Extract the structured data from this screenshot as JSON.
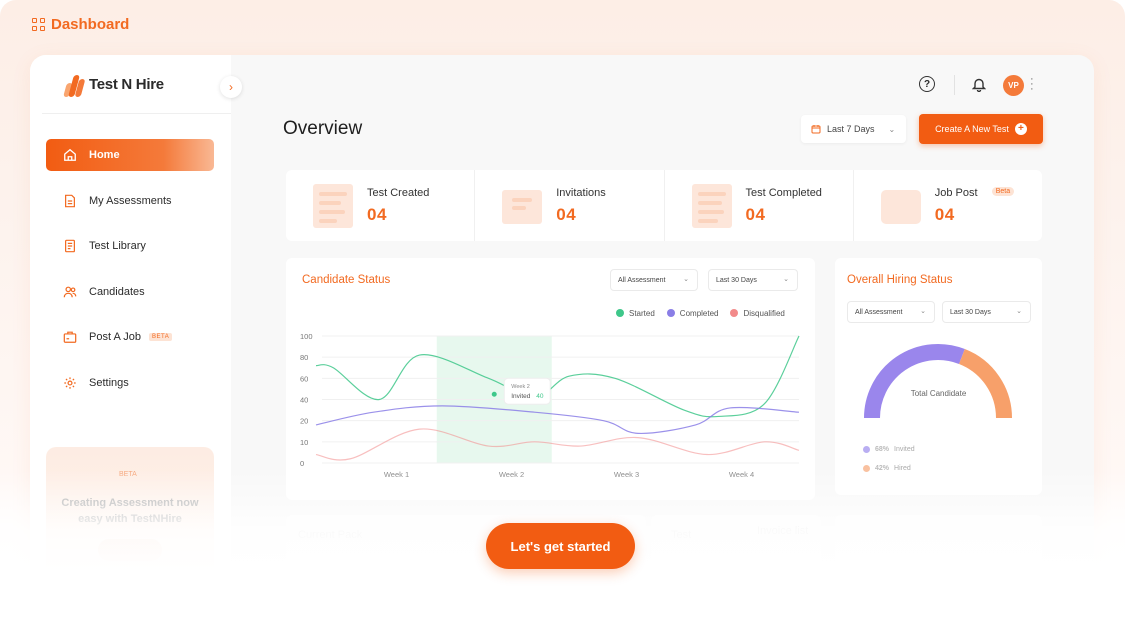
{
  "page": {
    "label": "Dashboard"
  },
  "brand": {
    "name": "Test N Hire"
  },
  "sidebar": {
    "items": [
      {
        "label": "Home",
        "icon": "home-icon",
        "active": true
      },
      {
        "label": "My Assessments",
        "icon": "document-icon"
      },
      {
        "label": "Test Library",
        "icon": "library-icon"
      },
      {
        "label": "Candidates",
        "icon": "users-icon"
      },
      {
        "label": "Post A Job",
        "icon": "job-icon",
        "badge": "BETA"
      },
      {
        "label": "Settings",
        "icon": "gear-icon"
      }
    ],
    "promo": {
      "badge": "BETA",
      "text": "Creating Assessment now easy with TestNHire"
    }
  },
  "header": {
    "avatar_initials": "VP"
  },
  "overview": {
    "title": "Overview",
    "date_filter": "Last 7 Days",
    "create_button": "Create A New Test"
  },
  "stats": [
    {
      "label": "Test Created",
      "value": "04"
    },
    {
      "label": "Invitations",
      "value": "04"
    },
    {
      "label": "Test Completed",
      "value": "04"
    },
    {
      "label": "Job Post",
      "value": "04",
      "badge": "Beta"
    }
  ],
  "candidate_status": {
    "title": "Candidate Status",
    "filter_assessment": "All Assessment",
    "filter_period": "Last 30 Days",
    "tooltip": {
      "label": "Week 2",
      "metric": "Invited",
      "value": "40"
    }
  },
  "chart_data": {
    "type": "line",
    "categories": [
      "Week 1",
      "Week 2",
      "Week 3",
      "Week 4"
    ],
    "ylim": [
      0,
      100
    ],
    "yticks": [
      0,
      10,
      20,
      40,
      60,
      80,
      100
    ],
    "legend_position": "top-right",
    "series": [
      {
        "name": "Started",
        "color": "#3ec78a",
        "x": [
          0,
          0.15,
          0.55,
          0.9,
          1.5,
          1.9,
          2.2,
          2.6,
          3.2,
          3.5,
          3.9,
          4.2
        ],
        "values": [
          72,
          70,
          40,
          82,
          60,
          42,
          62,
          60,
          30,
          24,
          36,
          100
        ]
      },
      {
        "name": "Completed",
        "color": "#8a7ee6",
        "x": [
          0,
          0.5,
          1.1,
          1.9,
          2.5,
          2.8,
          3.3,
          3.6,
          4.2
        ],
        "values": [
          18,
          28,
          34,
          28,
          20,
          14,
          18,
          32,
          28
        ]
      },
      {
        "name": "Disqualified",
        "color": "#f28a8a",
        "x": [
          0,
          0.3,
          0.9,
          1.5,
          1.9,
          2.3,
          2.8,
          3.4,
          3.9,
          4.2
        ],
        "values": [
          4,
          2,
          16,
          8,
          10,
          8,
          12,
          4,
          10,
          6
        ]
      }
    ]
  },
  "hiring_status": {
    "title": "Overall Hiring Status",
    "filter_assessment": "All Assessment",
    "filter_period": "Last 30 Days",
    "center_label": "Total Candidate",
    "segments": [
      {
        "name": "Invited",
        "percent": 68,
        "label": "68%",
        "color": "#9a86ec"
      },
      {
        "name": "Hired",
        "percent": 42,
        "label": "42%",
        "color": "#f7a06a"
      }
    ]
  },
  "ghost": {
    "left": "Current Pack",
    "mid": "Test",
    "right": "Invoice list"
  },
  "cta": {
    "label": "Let's get started"
  }
}
